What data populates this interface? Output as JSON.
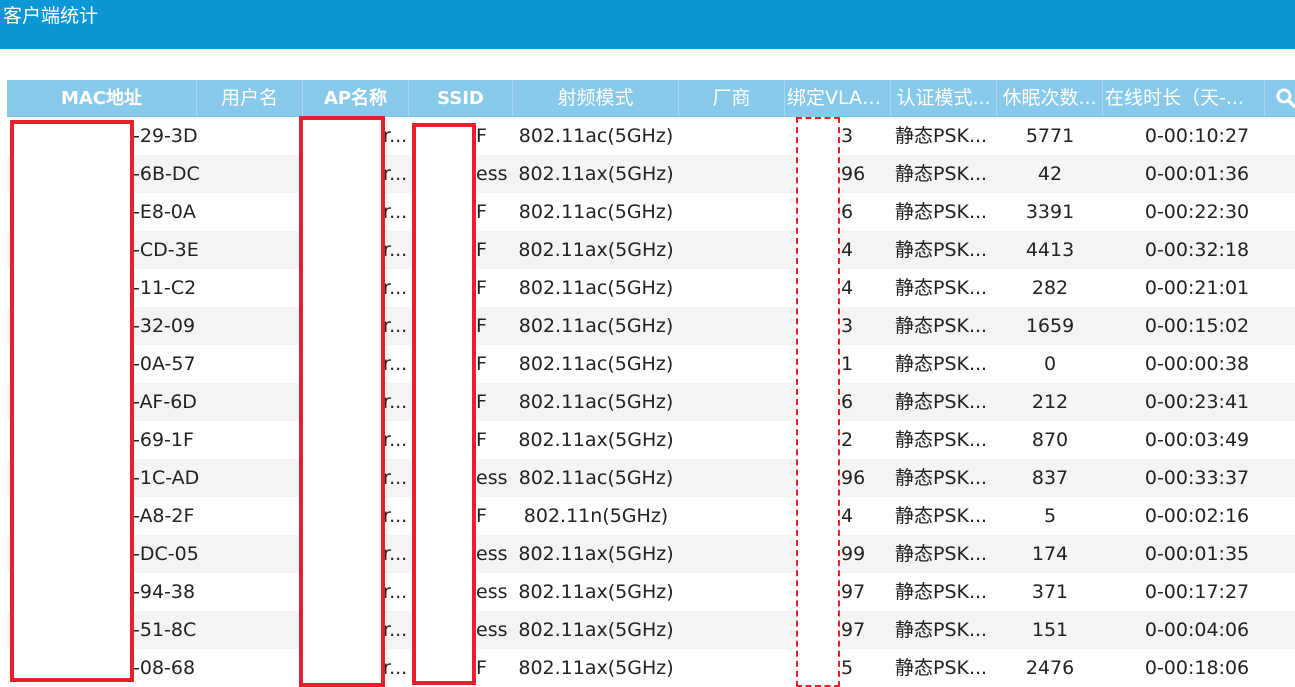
{
  "window": {
    "title": "客户端统计"
  },
  "table": {
    "columns": [
      {
        "key": "mac",
        "label": "MAC地址"
      },
      {
        "key": "user",
        "label": "用户名"
      },
      {
        "key": "ap",
        "label": "AP名称"
      },
      {
        "key": "ssid",
        "label": "SSID"
      },
      {
        "key": "radio",
        "label": "射频模式"
      },
      {
        "key": "vendor",
        "label": "厂商"
      },
      {
        "key": "vlan",
        "label": "绑定VLAN..."
      },
      {
        "key": "auth",
        "label": "认证模式..."
      },
      {
        "key": "sleep",
        "label": "休眠次数..."
      },
      {
        "key": "online",
        "label": "在线时长（天-..."
      }
    ],
    "rows": [
      {
        "mac": "-29-3D",
        "ap": "r...",
        "ssid": "F",
        "radio": "802.11ac(5GHz)",
        "vlan": "3",
        "auth": "静态PSK...",
        "sleep": "5771",
        "online": "0-00:10:27"
      },
      {
        "mac": "-6B-DC",
        "ap": "r...",
        "ssid": "ess",
        "radio": "802.11ax(5GHz)",
        "vlan": "96",
        "auth": "静态PSK...",
        "sleep": "42",
        "online": "0-00:01:36"
      },
      {
        "mac": "-E8-0A",
        "ap": "r...",
        "ssid": "F",
        "radio": "802.11ac(5GHz)",
        "vlan": "6",
        "auth": "静态PSK...",
        "sleep": "3391",
        "online": "0-00:22:30"
      },
      {
        "mac": "-CD-3E",
        "ap": "r...",
        "ssid": "F",
        "radio": "802.11ax(5GHz)",
        "vlan": "4",
        "auth": "静态PSK...",
        "sleep": "4413",
        "online": "0-00:32:18"
      },
      {
        "mac": "-11-C2",
        "ap": "r...",
        "ssid": "F",
        "radio": "802.11ac(5GHz)",
        "vlan": "4",
        "auth": "静态PSK...",
        "sleep": "282",
        "online": "0-00:21:01"
      },
      {
        "mac": "-32-09",
        "ap": "r...",
        "ssid": "F",
        "radio": "802.11ac(5GHz)",
        "vlan": "3",
        "auth": "静态PSK...",
        "sleep": "1659",
        "online": "0-00:15:02"
      },
      {
        "mac": "-0A-57",
        "ap": "r...",
        "ssid": "F",
        "radio": "802.11ac(5GHz)",
        "vlan": "1",
        "auth": "静态PSK...",
        "sleep": "0",
        "online": "0-00:00:38"
      },
      {
        "mac": "-AF-6D",
        "ap": "r...",
        "ssid": "F",
        "radio": "802.11ac(5GHz)",
        "vlan": "6",
        "auth": "静态PSK...",
        "sleep": "212",
        "online": "0-00:23:41"
      },
      {
        "mac": "-69-1F",
        "ap": "r...",
        "ssid": "F",
        "radio": "802.11ax(5GHz)",
        "vlan": "2",
        "auth": "静态PSK...",
        "sleep": "870",
        "online": "0-00:03:49"
      },
      {
        "mac": "-1C-AD",
        "ap": "r...",
        "ssid": "ess",
        "radio": "802.11ac(5GHz)",
        "vlan": "96",
        "auth": "静态PSK...",
        "sleep": "837",
        "online": "0-00:33:37"
      },
      {
        "mac": "-A8-2F",
        "ap": "r...",
        "ssid": "F",
        "radio": "802.11n(5GHz)",
        "vlan": "4",
        "auth": "静态PSK...",
        "sleep": "5",
        "online": "0-00:02:16"
      },
      {
        "mac": "-DC-05",
        "ap": "r...",
        "ssid": "ess",
        "radio": "802.11ax(5GHz)",
        "vlan": "99",
        "auth": "静态PSK...",
        "sleep": "174",
        "online": "0-00:01:35"
      },
      {
        "mac": "-94-38",
        "ap": "r...",
        "ssid": "ess",
        "radio": "802.11ax(5GHz)",
        "vlan": "97",
        "auth": "静态PSK...",
        "sleep": "371",
        "online": "0-00:17:27"
      },
      {
        "mac": "-51-8C",
        "ap": "r...",
        "ssid": "ess",
        "radio": "802.11ax(5GHz)",
        "vlan": "97",
        "auth": "静态PSK...",
        "sleep": "151",
        "online": "0-00:04:06"
      },
      {
        "mac": "-08-68",
        "ap": "r...",
        "ssid": "F",
        "radio": "802.11ax(5GHz)",
        "vlan": "5",
        "auth": "静态PSK...",
        "sleep": "2476",
        "online": "0-00:18:06"
      }
    ]
  },
  "icons": {
    "search": "search-icon"
  },
  "colors": {
    "titlebar": "#0b97d6",
    "header": "#87c9ea",
    "redaction": "#e8202a"
  }
}
